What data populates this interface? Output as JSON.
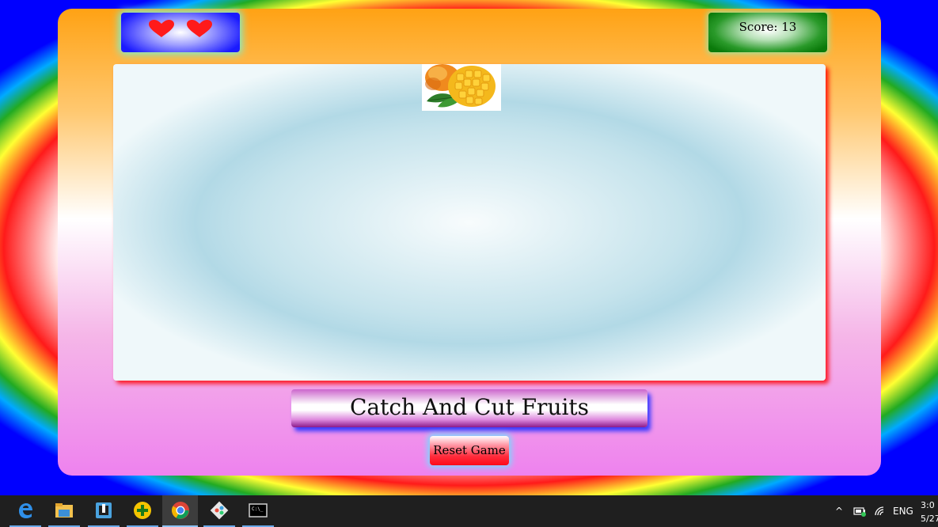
{
  "game": {
    "lives": 2,
    "score_label": "Score: 13",
    "title": "Catch And Cut Fruits",
    "reset_label": "Reset Game",
    "fruit": "mango"
  },
  "taskbar": {
    "pinned": [
      "edge-icon",
      "file-explorer-icon",
      "app-icon",
      "plus-app-icon",
      "chrome-icon",
      "git-icon",
      "terminal-icon"
    ],
    "active": "chrome-icon",
    "tray": {
      "chevron": "^",
      "language": "ENG",
      "time": "3:0",
      "date": "5/27"
    }
  },
  "colors": {
    "heart": "#ff1a1a",
    "play_area_shadow": "#ff0000",
    "title_shadow": "#3a3aff",
    "taskbar": "#1f1f1f"
  }
}
